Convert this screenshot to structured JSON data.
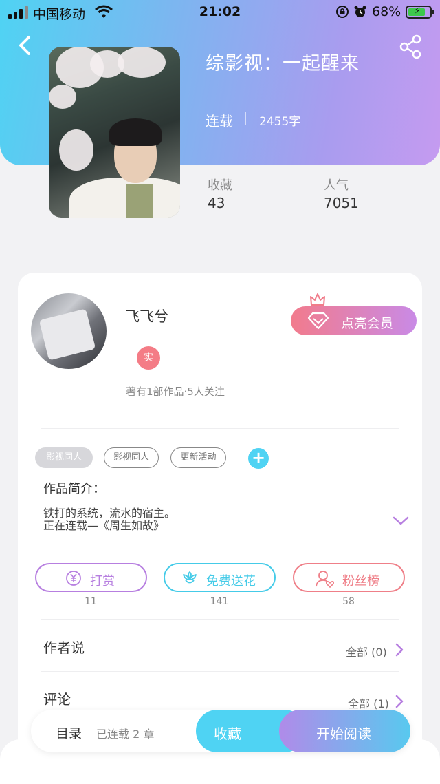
{
  "status_bar": {
    "carrier": "中国移动",
    "time": "21:02",
    "battery": "68%"
  },
  "book": {
    "title": "综影视：一起醒来",
    "status": "连载",
    "word_count": "2455字",
    "stats": [
      {
        "label": "收藏",
        "value": "43"
      },
      {
        "label": "人气",
        "value": "7051"
      }
    ]
  },
  "author": {
    "name": "飞飞兮",
    "badge": "实",
    "meta": "著有1部作品·5人关注",
    "vip_button": "点亮会员"
  },
  "tags": [
    "影视同人",
    "影视同人",
    "更新活动"
  ],
  "tag_add": "+",
  "intro": {
    "label": "作品简介：",
    "lines": [
      "铁打的系统，流水的宿主。",
      "正在连载—《周生如故》"
    ]
  },
  "actions": [
    {
      "label": "打赏",
      "count": "11",
      "color": "#b77fe0"
    },
    {
      "label": "免费送花",
      "count": "141",
      "color": "#45cbe8"
    },
    {
      "label": "粉丝榜",
      "count": "58",
      "color": "#ef7f88"
    }
  ],
  "sections": [
    {
      "title": "作者说",
      "right": "全部 (0)"
    },
    {
      "title": "评论",
      "right": "全部 (1)"
    }
  ],
  "bottom_bar": {
    "toc": "目录",
    "chapters": "已连载 2 章",
    "collect": "收藏",
    "read": "开始阅读"
  },
  "colors": {
    "accent_cyan": "#4fd3f3",
    "accent_purple": "#b77fe0",
    "accent_pink": "#ef7f88"
  },
  "icons": [
    "back-arrow-icon",
    "share-icon",
    "diamond-icon",
    "crown-icon",
    "yen-icon",
    "flower-icon",
    "fans-icon",
    "chevron-right-icon",
    "chevron-down-icon",
    "wifi-icon",
    "signal-icon",
    "battery-icon"
  ]
}
